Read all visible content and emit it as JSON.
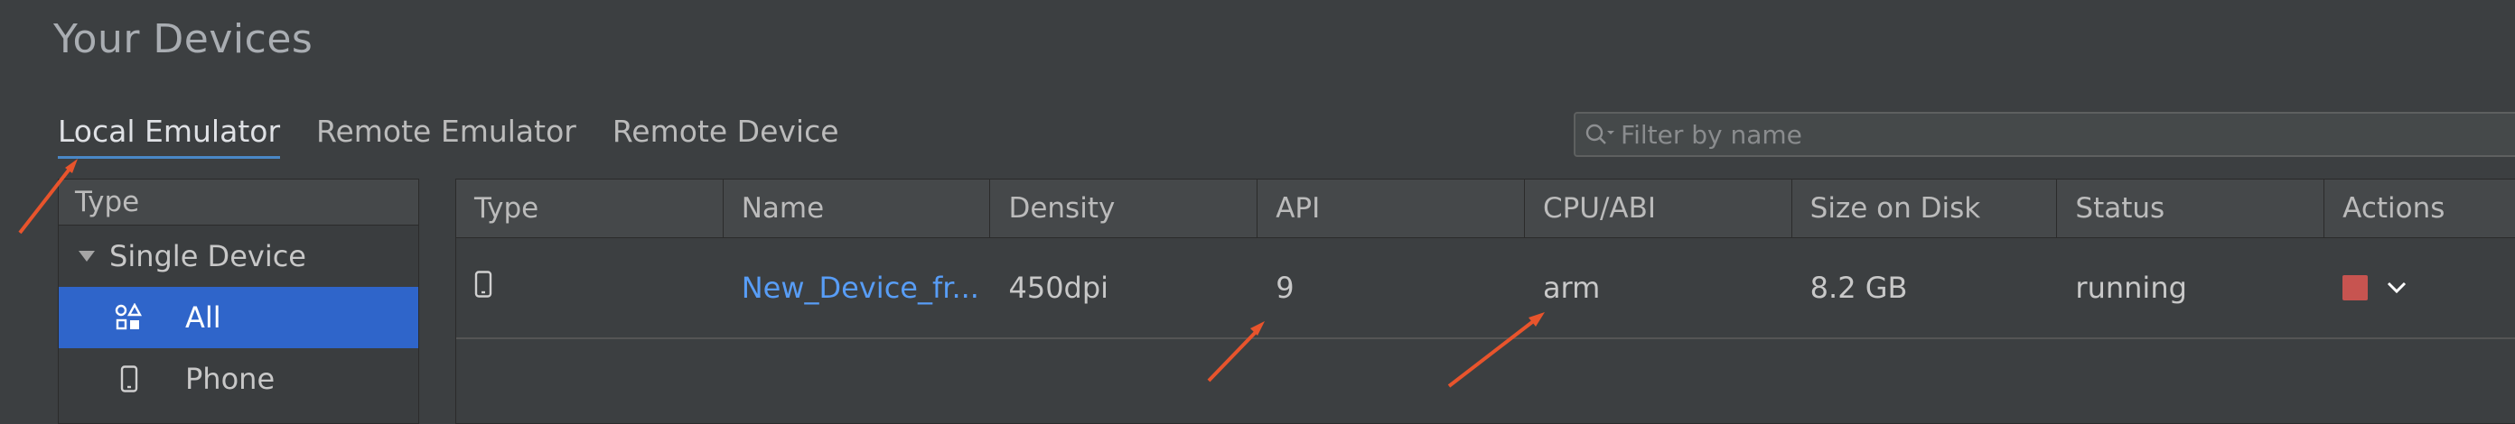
{
  "page": {
    "title": "Your Devices"
  },
  "tabs": [
    {
      "label": "Local Emulator",
      "active": true
    },
    {
      "label": "Remote Emulator",
      "active": false
    },
    {
      "label": "Remote Device",
      "active": false
    }
  ],
  "filter": {
    "placeholder": "Filter by name",
    "value": ""
  },
  "type_panel": {
    "header": "Type",
    "group": "Single Device",
    "items": [
      {
        "label": "All",
        "icon": "grid-shapes-icon",
        "selected": true
      },
      {
        "label": "Phone",
        "icon": "phone-icon",
        "selected": false
      }
    ]
  },
  "table": {
    "headers": [
      "Type",
      "Name",
      "Density",
      "API",
      "CPU/ABI",
      "Size on Disk",
      "Status",
      "Actions"
    ],
    "rows": [
      {
        "type_icon": "phone-icon",
        "name": "New_Device_fr...",
        "density": "450dpi",
        "api": "9",
        "cpu_abi": "arm",
        "size": "8.2 GB",
        "status": "running"
      }
    ]
  },
  "colors": {
    "background": "#3c3f41",
    "selection": "#2f65ca",
    "link": "#589df6",
    "stop": "#c75450",
    "annotation_arrow": "#e8542c"
  }
}
